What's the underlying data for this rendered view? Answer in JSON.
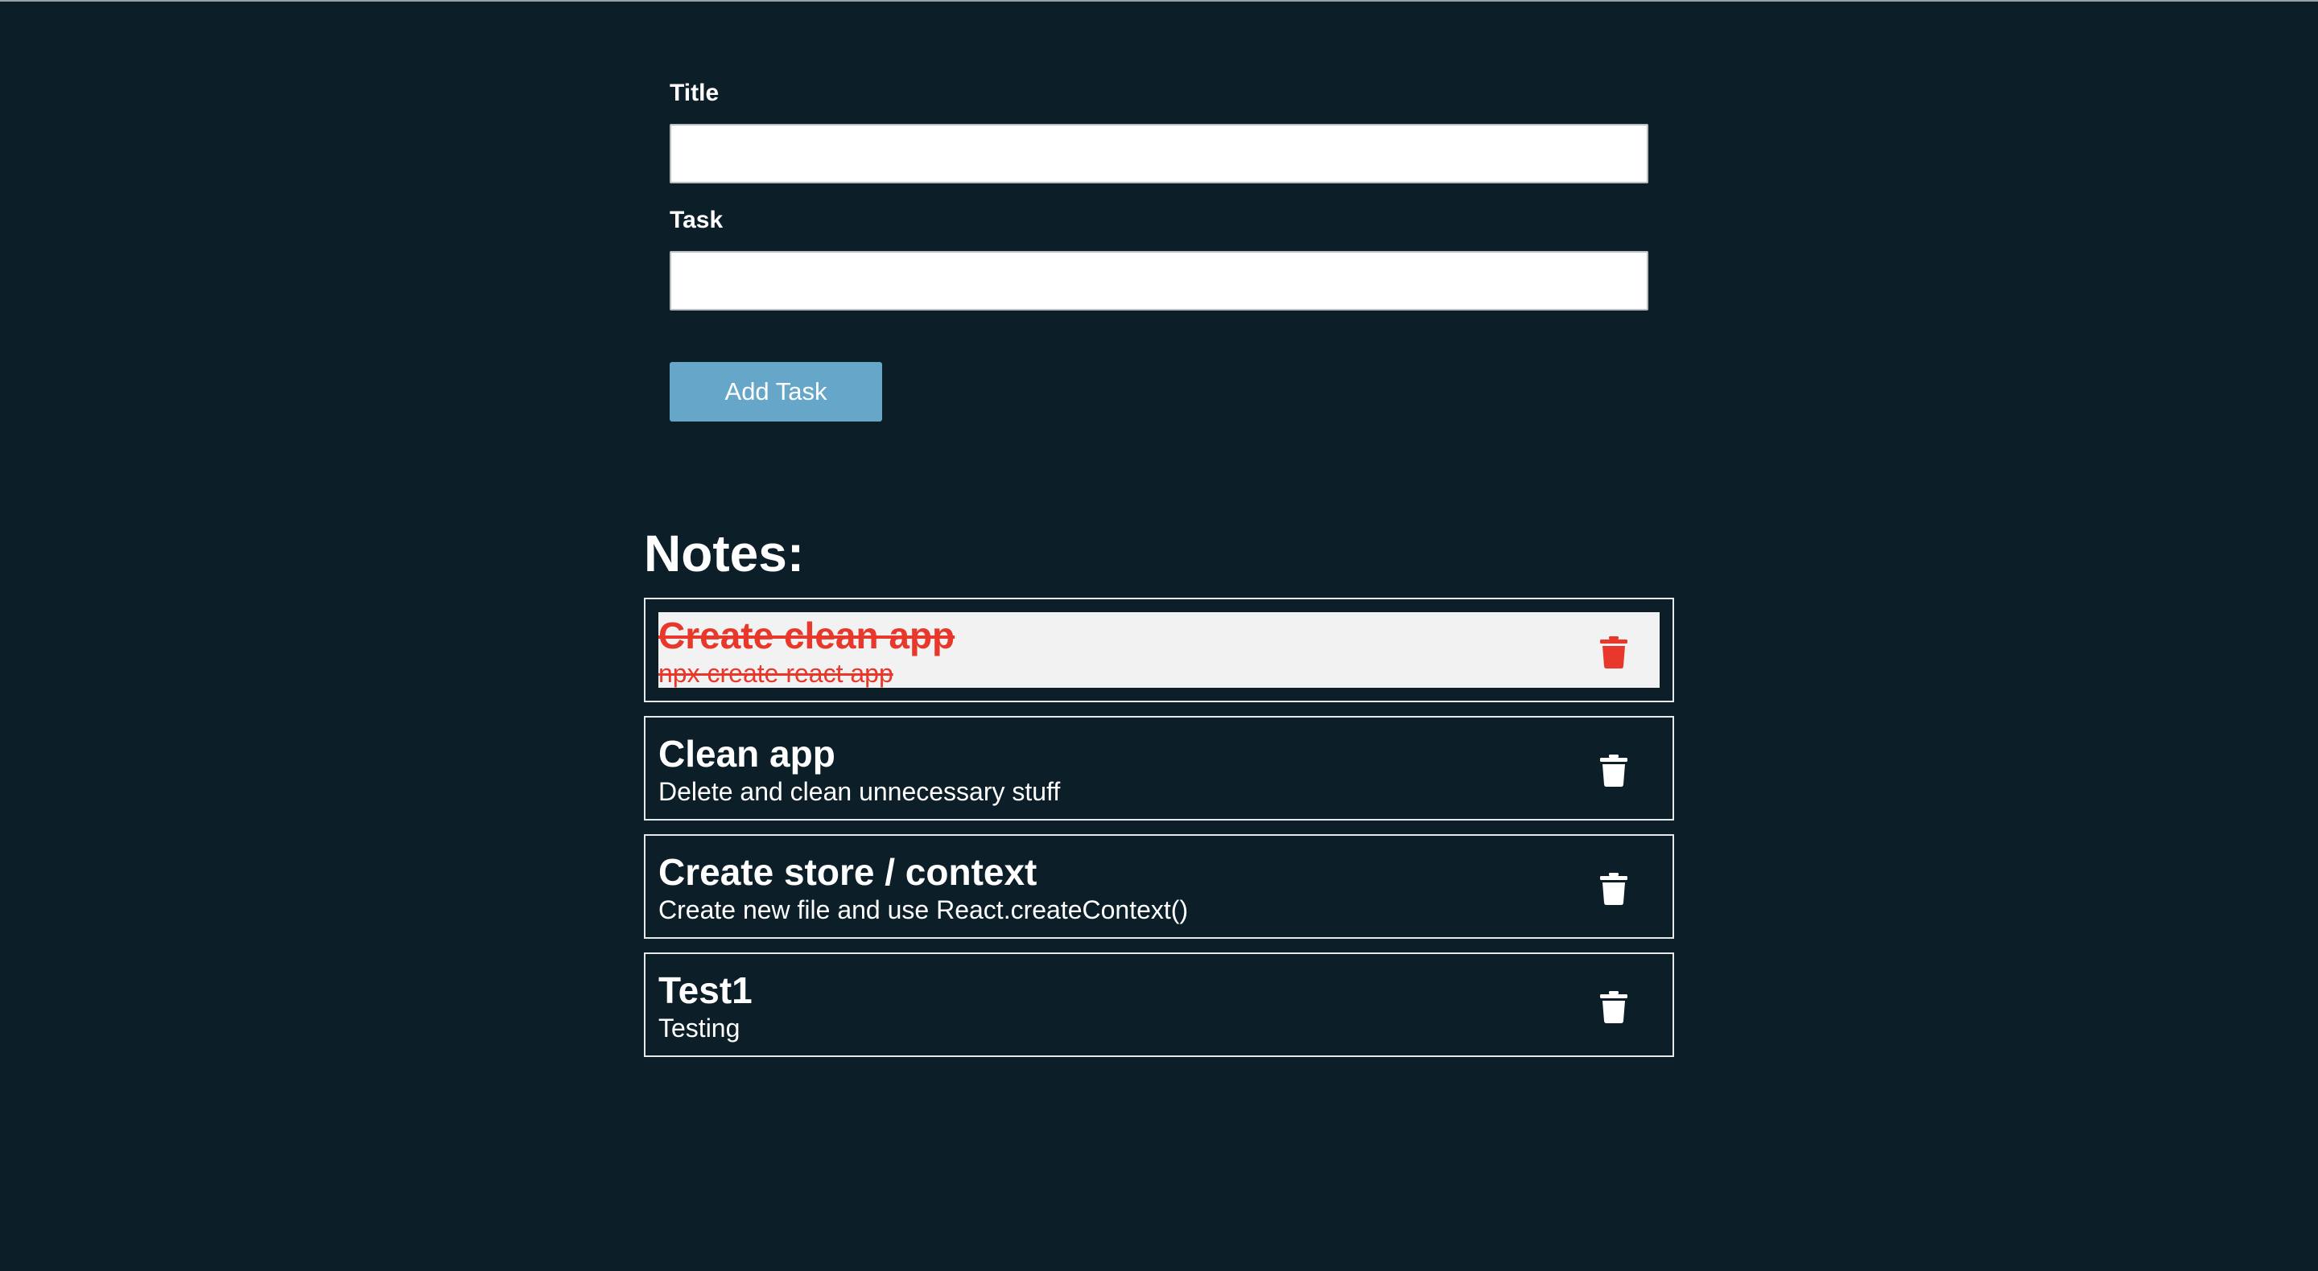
{
  "form": {
    "title_label": "Title",
    "title_value": "",
    "title_placeholder": "",
    "task_label": "Task",
    "task_value": "",
    "task_placeholder": "",
    "add_button_label": "Add Task"
  },
  "notes": {
    "heading": "Notes:",
    "items": [
      {
        "title": "Create clean app",
        "description": "npx create react app",
        "completed": true
      },
      {
        "title": "Clean app",
        "description": "Delete and clean unnecessary stuff",
        "completed": false
      },
      {
        "title": "Create store / context",
        "description": "Create new file and use React.createContext()",
        "completed": false
      },
      {
        "title": "Test1",
        "description": "Testing",
        "completed": false
      }
    ]
  },
  "icons": {
    "delete": "trash-icon"
  },
  "colors": {
    "background": "#0c1f29",
    "button": "#65a6c9",
    "completed_text": "#e8382b",
    "completed_row": "#f2f2f2",
    "border": "#e6e9eb"
  }
}
